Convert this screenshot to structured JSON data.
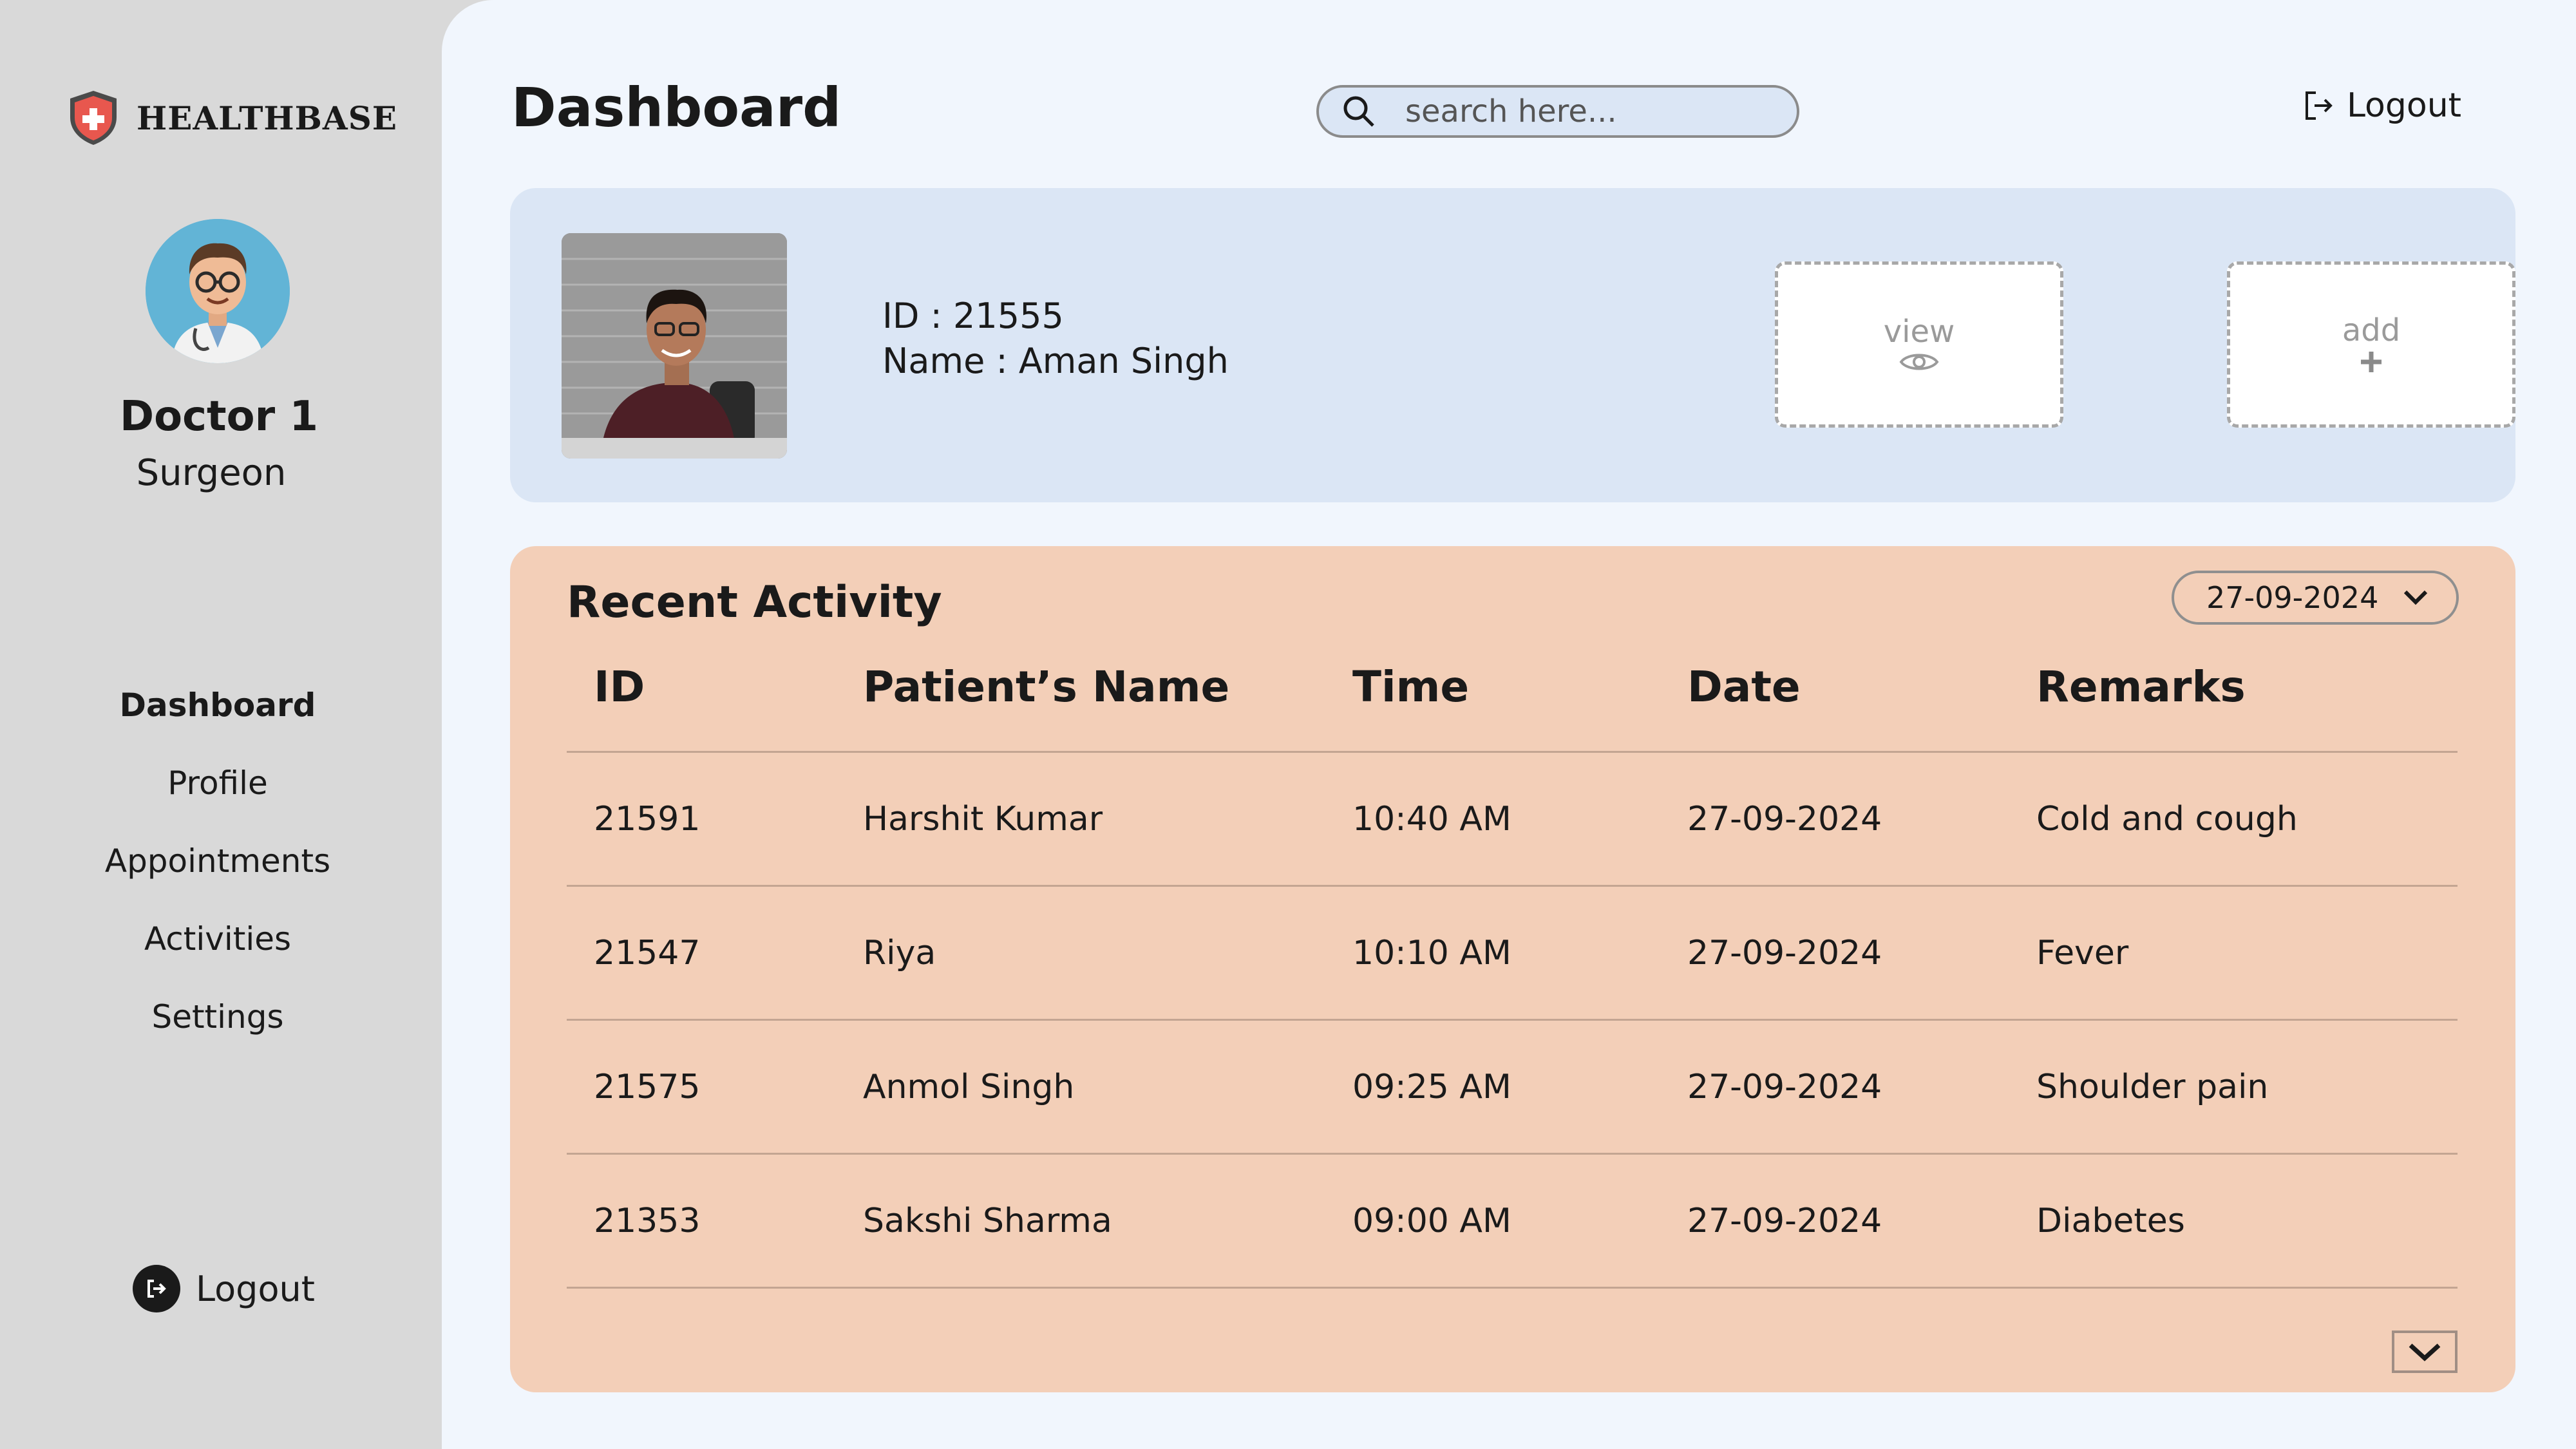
{
  "brand": {
    "name": "HEALTHBASE",
    "accent": "#e8574e"
  },
  "doctor": {
    "name": "Doctor 1",
    "role": "Surgeon"
  },
  "sidebar": {
    "items": [
      {
        "label": "Dashboard",
        "active": true
      },
      {
        "label": "Profile"
      },
      {
        "label": "Appointments"
      },
      {
        "label": "Activities"
      },
      {
        "label": "Settings"
      }
    ],
    "logout_label": "Logout"
  },
  "header": {
    "title": "Dashboard",
    "search_placeholder": "search here...",
    "logout_label": "Logout"
  },
  "patient": {
    "id_text": "ID : 21555",
    "name_text": "Name : Aman Singh",
    "view_label": "view",
    "add_label": "add"
  },
  "activity": {
    "title": "Recent Activity",
    "date_filter": "27-09-2024",
    "columns": [
      "ID",
      "Patient’s Name",
      "Time",
      "Date",
      "Remarks"
    ],
    "rows": [
      [
        "21591",
        "Harshit Kumar",
        "10:40 AM",
        "27-09-2024",
        "Cold and cough"
      ],
      [
        "21547",
        "Riya",
        "10:10 AM",
        "27-09-2024",
        "Fever"
      ],
      [
        "21575",
        "Anmol Singh",
        "09:25 AM",
        "27-09-2024",
        "Shoulder pain"
      ],
      [
        "21353",
        "Sakshi Sharma",
        "09:00 AM",
        "27-09-2024",
        "Diabetes"
      ]
    ]
  },
  "colors": {
    "sidebar_bg": "#d9d9d9",
    "main_bg": "#f1f6fd",
    "card_bg": "#dbe6f5",
    "activity_bg": "#f3cfb8"
  }
}
